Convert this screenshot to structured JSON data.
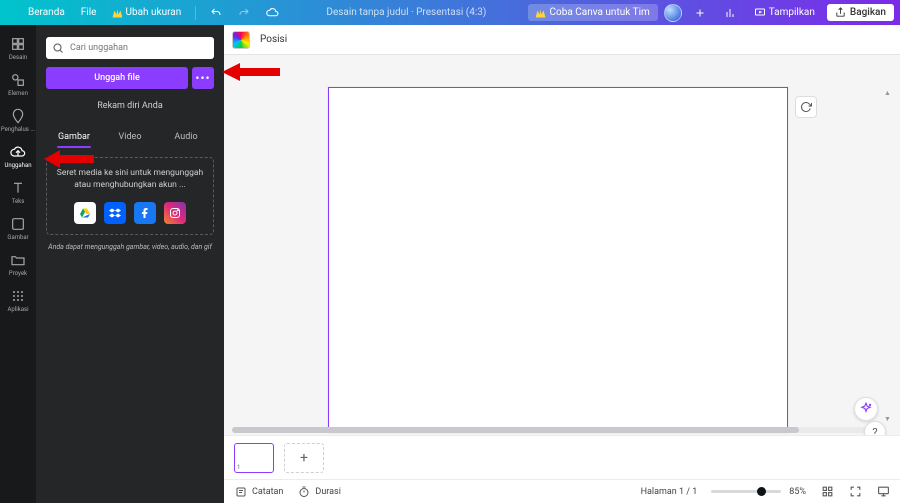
{
  "topbar": {
    "home": "Beranda",
    "file": "File",
    "resize": "Ubah ukuran",
    "doc_title": "Desain tanpa judul · Presentasi (4:3)",
    "try_team": "Coba Canva untuk Tim",
    "present": "Tampilkan",
    "share": "Bagikan"
  },
  "rail": {
    "design": "Desain",
    "elements": "Elemen",
    "brand": "Penghalus ...",
    "uploads": "Unggahan",
    "text": "Teks",
    "draw": "Gambar",
    "projects": "Proyek",
    "apps": "Aplikasi"
  },
  "panel": {
    "search_placeholder": "Cari unggahan",
    "upload": "Unggah file",
    "record": "Rekam diri Anda",
    "tabs": {
      "images": "Gambar",
      "video": "Video",
      "audio": "Audio"
    },
    "dropzone": "Seret media ke sini untuk mengunggah atau menghubungkan akun ...",
    "hint": "Anda dapat mengunggah gambar, video, audio, dan gif"
  },
  "subtoolbar": {
    "position": "Posisi"
  },
  "strip": {
    "page_num": "1"
  },
  "footer": {
    "notes": "Catatan",
    "duration": "Durasi",
    "page_indicator": "Halaman 1 / 1",
    "zoom": "85%"
  }
}
